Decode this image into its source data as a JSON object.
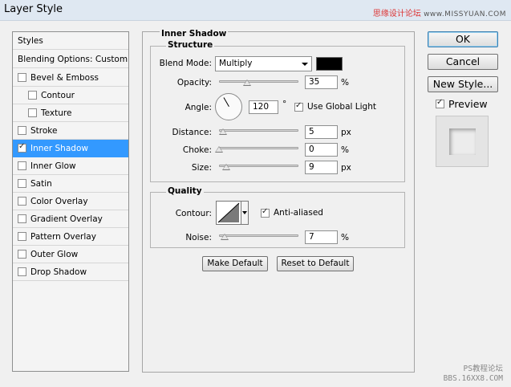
{
  "window": {
    "title": "Layer Style",
    "watermark_top_cn": "思缘设计论坛",
    "watermark_top_site": "www.MISSYUAN.COM"
  },
  "styles_list": {
    "header": "Styles",
    "blending": "Blending Options: Custom",
    "items": [
      {
        "label": "Bevel & Emboss",
        "checked": false
      },
      {
        "label": "Contour",
        "checked": false
      },
      {
        "label": "Texture",
        "checked": false
      },
      {
        "label": "Stroke",
        "checked": false
      },
      {
        "label": "Inner Shadow",
        "checked": true
      },
      {
        "label": "Inner Glow",
        "checked": false
      },
      {
        "label": "Satin",
        "checked": false
      },
      {
        "label": "Color Overlay",
        "checked": false
      },
      {
        "label": "Gradient Overlay",
        "checked": false
      },
      {
        "label": "Pattern Overlay",
        "checked": false
      },
      {
        "label": "Outer Glow",
        "checked": false
      },
      {
        "label": "Drop Shadow",
        "checked": false
      }
    ]
  },
  "panel": {
    "title": "Inner Shadow",
    "structure": {
      "title": "Structure",
      "blend_mode_label": "Blend Mode:",
      "blend_mode_value": "Multiply",
      "color": "#000000",
      "opacity_label": "Opacity:",
      "opacity_value": "35",
      "opacity_unit": "%",
      "opacity_fraction": 0.35,
      "angle_label": "Angle:",
      "angle_value": "120",
      "angle_unit": "°",
      "use_global_light_label": "Use Global Light",
      "use_global_light_checked": true,
      "distance_label": "Distance:",
      "distance_value": "5",
      "distance_unit": "px",
      "choke_label": "Choke:",
      "choke_value": "0",
      "choke_unit": "%",
      "size_label": "Size:",
      "size_value": "9",
      "size_unit": "px"
    },
    "quality": {
      "title": "Quality",
      "contour_label": "Contour:",
      "anti_aliased_label": "Anti-aliased",
      "anti_aliased_checked": true,
      "noise_label": "Noise:",
      "noise_value": "7",
      "noise_unit": "%"
    },
    "make_default": "Make Default",
    "reset_default": "Reset to Default"
  },
  "actions": {
    "ok": "OK",
    "cancel": "Cancel",
    "new_style": "New Style...",
    "preview_label": "Preview",
    "preview_checked": true
  },
  "watermark_bottom": {
    "line1": "PS教程论坛",
    "line2": "BBS.16XX8.COM"
  }
}
